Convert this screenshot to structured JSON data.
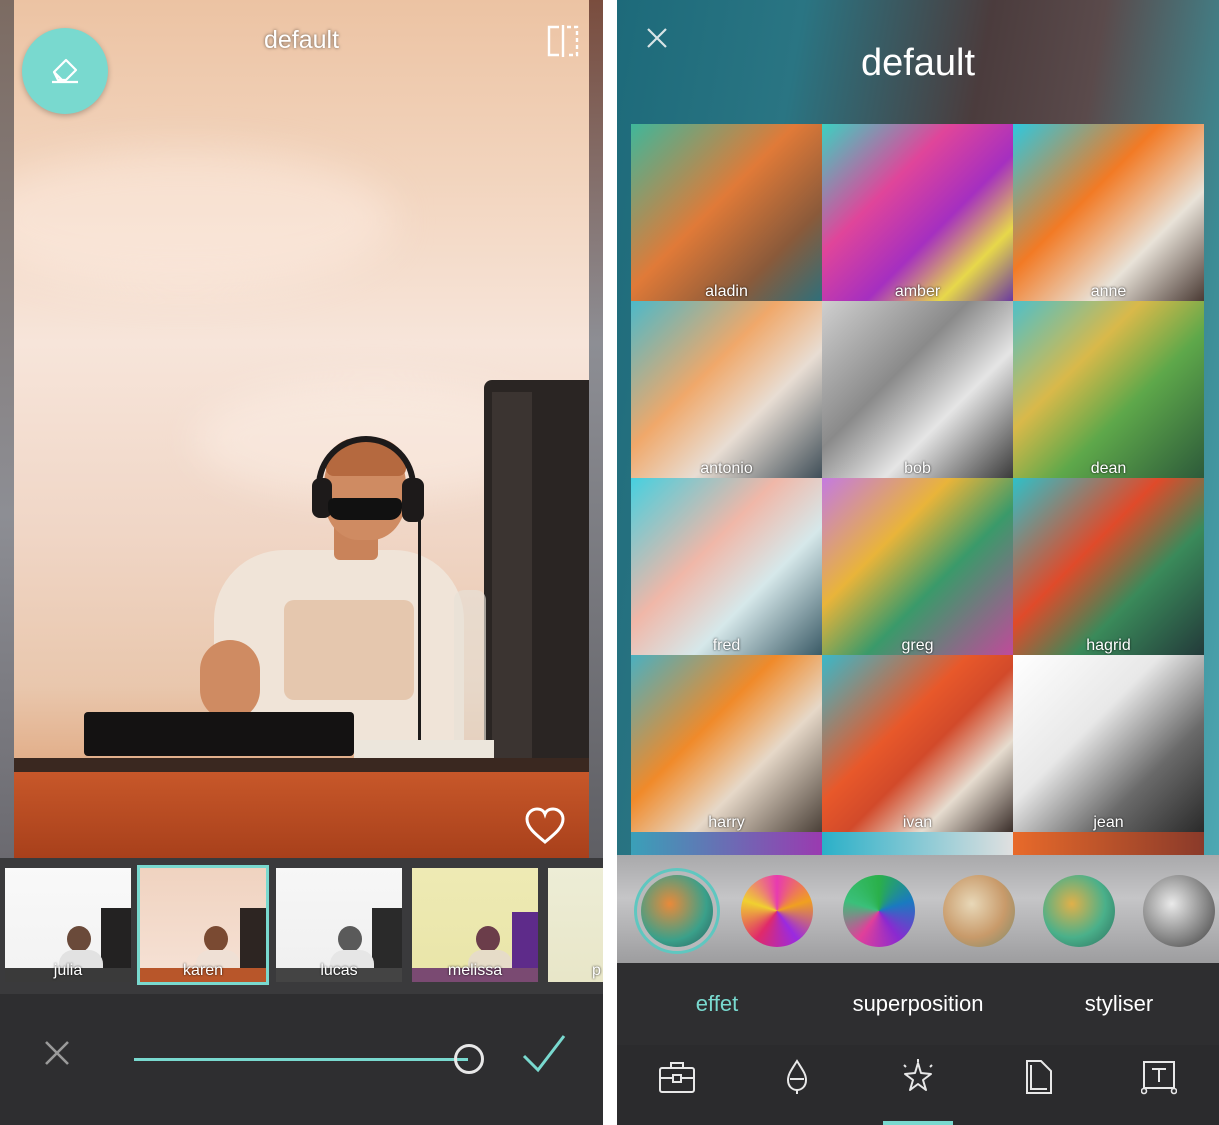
{
  "editor": {
    "title": "default",
    "strength_value": 100,
    "filters": [
      {
        "label": "julia"
      },
      {
        "label": "karen",
        "selected": true
      },
      {
        "label": "lucas"
      },
      {
        "label": "melissa"
      },
      {
        "label": "p"
      }
    ],
    "icons": {
      "eraser": "eraser-icon",
      "compare": "compare-icon",
      "favorite": "heart-icon",
      "cancel": "close-icon",
      "confirm": "check-icon"
    },
    "accent_color": "#79d9cf"
  },
  "effects_browser": {
    "title": "default",
    "presets": [
      {
        "label": "aladin"
      },
      {
        "label": "amber"
      },
      {
        "label": "anne"
      },
      {
        "label": "antonio"
      },
      {
        "label": "bob"
      },
      {
        "label": "dean"
      },
      {
        "label": "fred"
      },
      {
        "label": "greg"
      },
      {
        "label": "hagrid"
      },
      {
        "label": "harry"
      },
      {
        "label": "ivan"
      },
      {
        "label": "jean"
      }
    ],
    "categories": 6,
    "tabs": [
      {
        "label": "effet",
        "active": true
      },
      {
        "label": "superposition"
      },
      {
        "label": "styliser"
      }
    ],
    "tools": [
      "toolbox-icon",
      "drop-icon",
      "sparkle-icon",
      "pages-icon",
      "text-frame-icon"
    ],
    "active_tool": "sparkle-icon"
  }
}
